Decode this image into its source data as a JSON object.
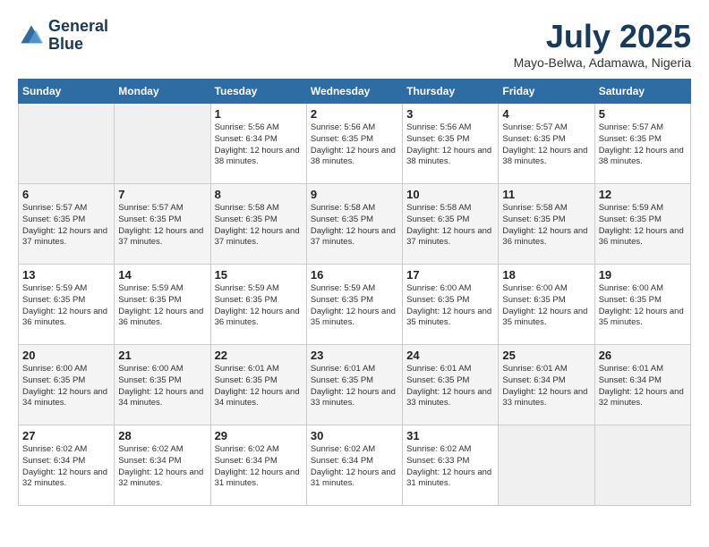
{
  "header": {
    "logo_line1": "General",
    "logo_line2": "Blue",
    "month_title": "July 2025",
    "location": "Mayo-Belwa, Adamawa, Nigeria"
  },
  "days_of_week": [
    "Sunday",
    "Monday",
    "Tuesday",
    "Wednesday",
    "Thursday",
    "Friday",
    "Saturday"
  ],
  "weeks": [
    [
      {
        "num": "",
        "empty": true
      },
      {
        "num": "",
        "empty": true
      },
      {
        "num": "1",
        "sunrise": "Sunrise: 5:56 AM",
        "sunset": "Sunset: 6:34 PM",
        "daylight": "Daylight: 12 hours and 38 minutes."
      },
      {
        "num": "2",
        "sunrise": "Sunrise: 5:56 AM",
        "sunset": "Sunset: 6:35 PM",
        "daylight": "Daylight: 12 hours and 38 minutes."
      },
      {
        "num": "3",
        "sunrise": "Sunrise: 5:56 AM",
        "sunset": "Sunset: 6:35 PM",
        "daylight": "Daylight: 12 hours and 38 minutes."
      },
      {
        "num": "4",
        "sunrise": "Sunrise: 5:57 AM",
        "sunset": "Sunset: 6:35 PM",
        "daylight": "Daylight: 12 hours and 38 minutes."
      },
      {
        "num": "5",
        "sunrise": "Sunrise: 5:57 AM",
        "sunset": "Sunset: 6:35 PM",
        "daylight": "Daylight: 12 hours and 38 minutes."
      }
    ],
    [
      {
        "num": "6",
        "sunrise": "Sunrise: 5:57 AM",
        "sunset": "Sunset: 6:35 PM",
        "daylight": "Daylight: 12 hours and 37 minutes."
      },
      {
        "num": "7",
        "sunrise": "Sunrise: 5:57 AM",
        "sunset": "Sunset: 6:35 PM",
        "daylight": "Daylight: 12 hours and 37 minutes."
      },
      {
        "num": "8",
        "sunrise": "Sunrise: 5:58 AM",
        "sunset": "Sunset: 6:35 PM",
        "daylight": "Daylight: 12 hours and 37 minutes."
      },
      {
        "num": "9",
        "sunrise": "Sunrise: 5:58 AM",
        "sunset": "Sunset: 6:35 PM",
        "daylight": "Daylight: 12 hours and 37 minutes."
      },
      {
        "num": "10",
        "sunrise": "Sunrise: 5:58 AM",
        "sunset": "Sunset: 6:35 PM",
        "daylight": "Daylight: 12 hours and 37 minutes."
      },
      {
        "num": "11",
        "sunrise": "Sunrise: 5:58 AM",
        "sunset": "Sunset: 6:35 PM",
        "daylight": "Daylight: 12 hours and 36 minutes."
      },
      {
        "num": "12",
        "sunrise": "Sunrise: 5:59 AM",
        "sunset": "Sunset: 6:35 PM",
        "daylight": "Daylight: 12 hours and 36 minutes."
      }
    ],
    [
      {
        "num": "13",
        "sunrise": "Sunrise: 5:59 AM",
        "sunset": "Sunset: 6:35 PM",
        "daylight": "Daylight: 12 hours and 36 minutes."
      },
      {
        "num": "14",
        "sunrise": "Sunrise: 5:59 AM",
        "sunset": "Sunset: 6:35 PM",
        "daylight": "Daylight: 12 hours and 36 minutes."
      },
      {
        "num": "15",
        "sunrise": "Sunrise: 5:59 AM",
        "sunset": "Sunset: 6:35 PM",
        "daylight": "Daylight: 12 hours and 36 minutes."
      },
      {
        "num": "16",
        "sunrise": "Sunrise: 5:59 AM",
        "sunset": "Sunset: 6:35 PM",
        "daylight": "Daylight: 12 hours and 35 minutes."
      },
      {
        "num": "17",
        "sunrise": "Sunrise: 6:00 AM",
        "sunset": "Sunset: 6:35 PM",
        "daylight": "Daylight: 12 hours and 35 minutes."
      },
      {
        "num": "18",
        "sunrise": "Sunrise: 6:00 AM",
        "sunset": "Sunset: 6:35 PM",
        "daylight": "Daylight: 12 hours and 35 minutes."
      },
      {
        "num": "19",
        "sunrise": "Sunrise: 6:00 AM",
        "sunset": "Sunset: 6:35 PM",
        "daylight": "Daylight: 12 hours and 35 minutes."
      }
    ],
    [
      {
        "num": "20",
        "sunrise": "Sunrise: 6:00 AM",
        "sunset": "Sunset: 6:35 PM",
        "daylight": "Daylight: 12 hours and 34 minutes."
      },
      {
        "num": "21",
        "sunrise": "Sunrise: 6:00 AM",
        "sunset": "Sunset: 6:35 PM",
        "daylight": "Daylight: 12 hours and 34 minutes."
      },
      {
        "num": "22",
        "sunrise": "Sunrise: 6:01 AM",
        "sunset": "Sunset: 6:35 PM",
        "daylight": "Daylight: 12 hours and 34 minutes."
      },
      {
        "num": "23",
        "sunrise": "Sunrise: 6:01 AM",
        "sunset": "Sunset: 6:35 PM",
        "daylight": "Daylight: 12 hours and 33 minutes."
      },
      {
        "num": "24",
        "sunrise": "Sunrise: 6:01 AM",
        "sunset": "Sunset: 6:35 PM",
        "daylight": "Daylight: 12 hours and 33 minutes."
      },
      {
        "num": "25",
        "sunrise": "Sunrise: 6:01 AM",
        "sunset": "Sunset: 6:34 PM",
        "daylight": "Daylight: 12 hours and 33 minutes."
      },
      {
        "num": "26",
        "sunrise": "Sunrise: 6:01 AM",
        "sunset": "Sunset: 6:34 PM",
        "daylight": "Daylight: 12 hours and 32 minutes."
      }
    ],
    [
      {
        "num": "27",
        "sunrise": "Sunrise: 6:02 AM",
        "sunset": "Sunset: 6:34 PM",
        "daylight": "Daylight: 12 hours and 32 minutes."
      },
      {
        "num": "28",
        "sunrise": "Sunrise: 6:02 AM",
        "sunset": "Sunset: 6:34 PM",
        "daylight": "Daylight: 12 hours and 32 minutes."
      },
      {
        "num": "29",
        "sunrise": "Sunrise: 6:02 AM",
        "sunset": "Sunset: 6:34 PM",
        "daylight": "Daylight: 12 hours and 31 minutes."
      },
      {
        "num": "30",
        "sunrise": "Sunrise: 6:02 AM",
        "sunset": "Sunset: 6:34 PM",
        "daylight": "Daylight: 12 hours and 31 minutes."
      },
      {
        "num": "31",
        "sunrise": "Sunrise: 6:02 AM",
        "sunset": "Sunset: 6:33 PM",
        "daylight": "Daylight: 12 hours and 31 minutes."
      },
      {
        "num": "",
        "empty": true
      },
      {
        "num": "",
        "empty": true
      }
    ]
  ]
}
